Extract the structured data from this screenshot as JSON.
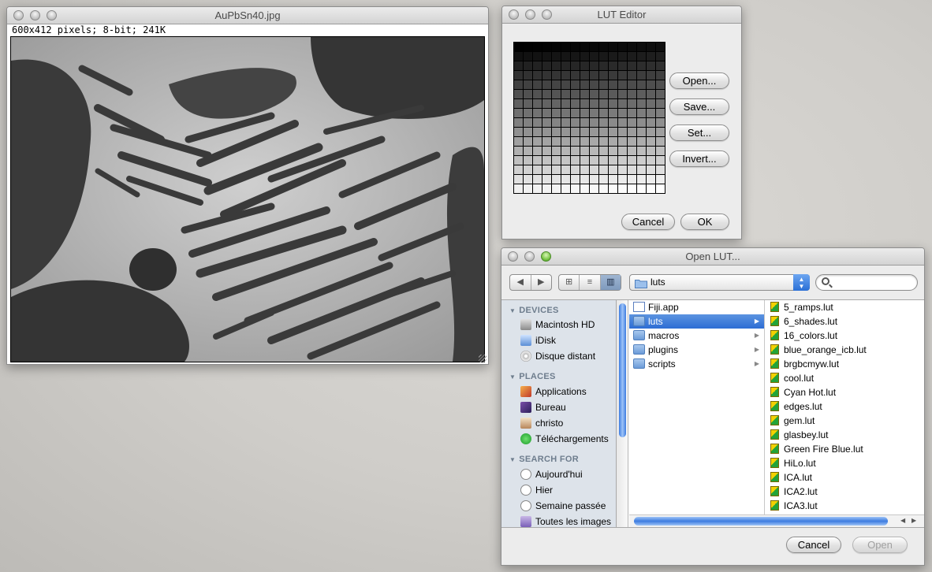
{
  "image_window": {
    "title": "AuPbSn40.jpg",
    "info": "600x412 pixels; 8-bit; 241K"
  },
  "lut_editor": {
    "title": "LUT Editor",
    "buttons": {
      "open": "Open...",
      "save": "Save...",
      "set": "Set...",
      "invert": "Invert...",
      "cancel": "Cancel",
      "ok": "OK"
    }
  },
  "open_dialog": {
    "title": "Open LUT...",
    "path": "luts",
    "view_modes": [
      "⊞",
      "≡",
      "▥"
    ],
    "search_placeholder": "",
    "sidebar": {
      "devices_label": "DEVICES",
      "devices": [
        "Macintosh HD",
        "iDisk",
        "Disque distant"
      ],
      "places_label": "PLACES",
      "places": [
        "Applications",
        "Bureau",
        "christo",
        "Téléchargements"
      ],
      "search_label": "SEARCH FOR",
      "searches": [
        "Aujourd'hui",
        "Hier",
        "Semaine passée",
        "Toutes les images"
      ]
    },
    "column1": [
      "Fiji.app",
      "luts",
      "macros",
      "plugins",
      "scripts"
    ],
    "column2": [
      "5_ramps.lut",
      "6_shades.lut",
      "16_colors.lut",
      "blue_orange_icb.lut",
      "brgbcmyw.lut",
      "cool.lut",
      "Cyan Hot.lut",
      "edges.lut",
      "gem.lut",
      "glasbey.lut",
      "Green Fire Blue.lut",
      "HiLo.lut",
      "ICA.lut",
      "ICA2.lut",
      "ICA3.lut"
    ],
    "buttons": {
      "cancel": "Cancel",
      "open": "Open"
    }
  }
}
